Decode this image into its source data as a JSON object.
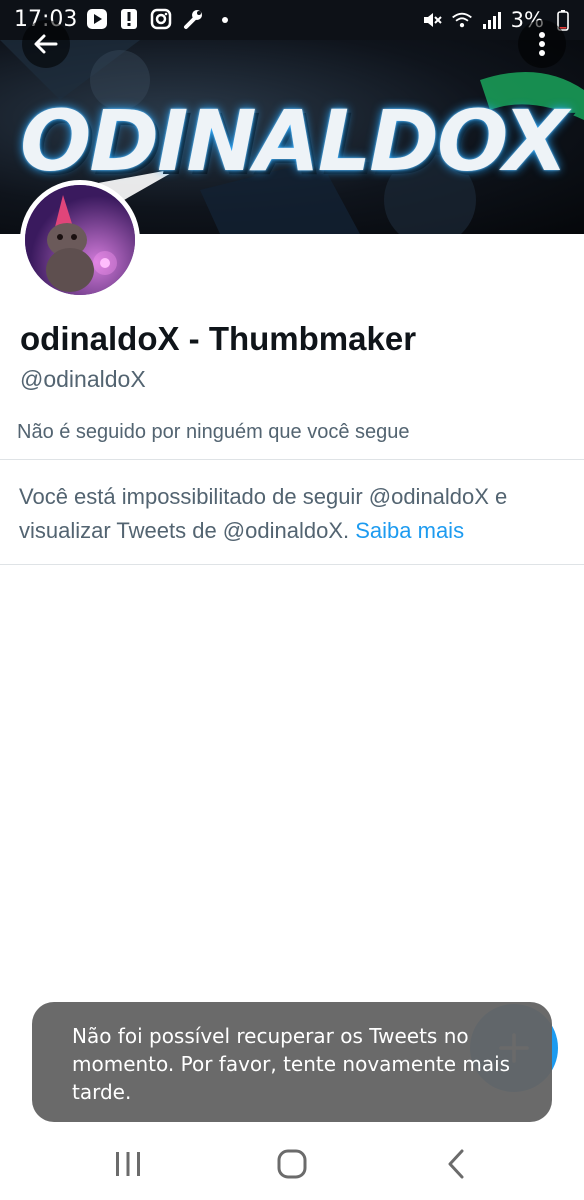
{
  "status_bar": {
    "time": "17:03",
    "battery": "3%",
    "left_icons": [
      "youtube-play-icon",
      "alert-icon",
      "instagram-icon",
      "wrench-icon",
      "dot-icon"
    ],
    "right_icons": [
      "mute-icon",
      "wifi-icon",
      "signal-icon"
    ]
  },
  "banner": {
    "text": "ODINALDOX",
    "accent": "#2aa9ff"
  },
  "header": {
    "back_icon": "arrow-left-icon",
    "more_icon": "more-vertical-icon"
  },
  "profile": {
    "display_name": "odinaldoX - Thumbmaker",
    "handle": "@odinaldoX",
    "followed_by": "Não é seguido por ninguém que você segue",
    "blocked_message": "Você está impossibilitado de seguir @odinaldoX e visualizar Tweets de @odinaldoX. ",
    "learn_more": "Saiba mais"
  },
  "snackbar": {
    "message": "Não foi possível recuperar os Tweets no momento. Por favor, tente novamente mais tarde."
  },
  "fab": {
    "icon": "plus-icon",
    "color": "#1d9bf0"
  },
  "nav": {
    "icons": [
      "recents-icon",
      "home-icon",
      "back-icon"
    ]
  },
  "colors": {
    "text_primary": "#0f1419",
    "text_secondary": "#536471",
    "link": "#1d9bf0"
  }
}
